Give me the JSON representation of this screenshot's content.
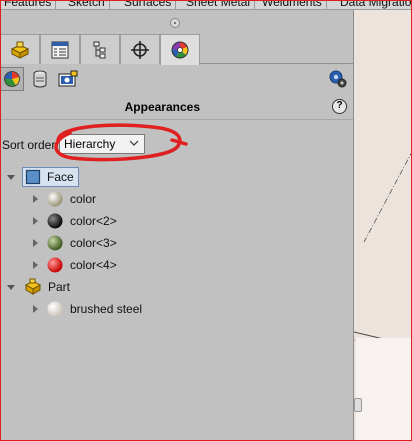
{
  "command_tabs": [
    "Features",
    "Sketch",
    "Surfaces",
    "Sheet Metal",
    "Weldments",
    "Data Migration"
  ],
  "manager_tabs": [
    {
      "icon": "feature-manager-icon"
    },
    {
      "icon": "property-manager-icon"
    },
    {
      "icon": "configuration-manager-icon"
    },
    {
      "icon": "dimxpert-manager-icon"
    },
    {
      "icon": "display-manager-icon"
    }
  ],
  "sub_toolbar": [
    {
      "icon": "appearances-view-icon",
      "active": true
    },
    {
      "icon": "decals-view-icon"
    },
    {
      "icon": "scenes-lights-cameras-icon"
    },
    {
      "icon": "appearance-settings-icon"
    }
  ],
  "panel": {
    "title": "Appearances",
    "help": "?"
  },
  "sort": {
    "label": "Sort order",
    "value": "Hierarchy"
  },
  "tree": {
    "face": {
      "label": "Face",
      "colors": [
        {
          "label": "color",
          "swatch": "#9a9478"
        },
        {
          "label": "color<2>",
          "swatch": "#1a1a1a"
        },
        {
          "label": "color<3>",
          "swatch": "#4d6b2a"
        },
        {
          "label": "color<4>",
          "swatch": "#e01010"
        }
      ]
    },
    "part": {
      "label": "Part",
      "items": [
        {
          "label": "brushed steel",
          "swatch": "#e2dcd6"
        }
      ]
    }
  },
  "colors": {
    "annotation": "#e02020",
    "selection_fill": "#d6e2f0",
    "selection_border": "#6b8bb5"
  }
}
